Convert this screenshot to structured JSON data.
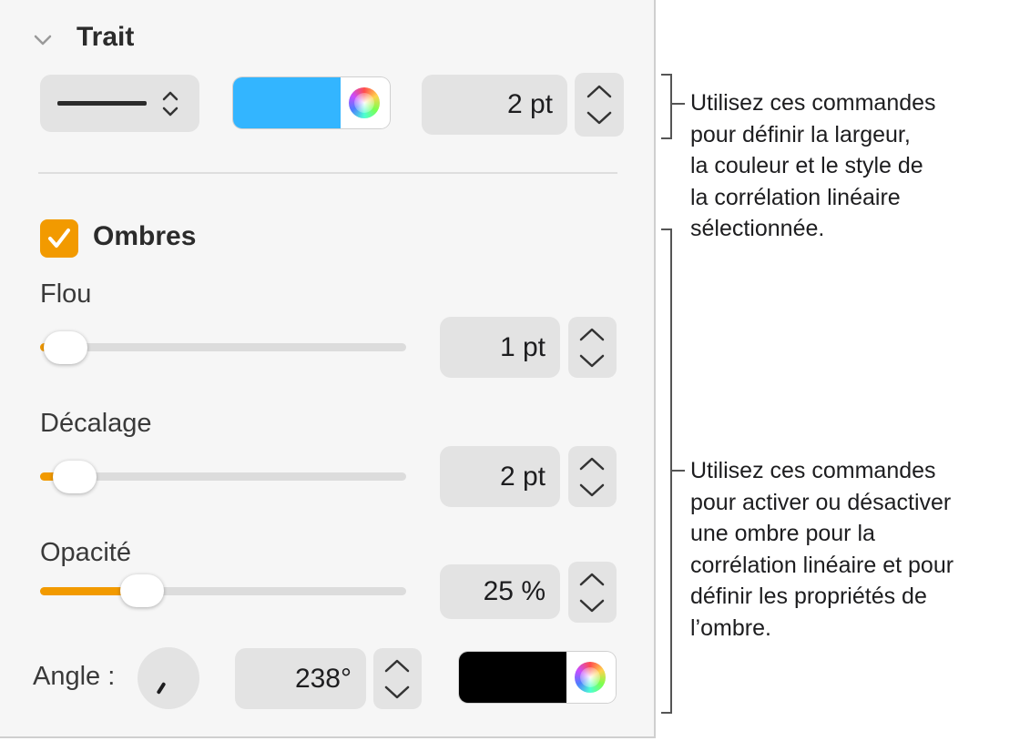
{
  "stroke": {
    "title": "Trait",
    "line_style": "solid-line",
    "color": "#33b5ff",
    "width_value": "2 pt"
  },
  "shadow": {
    "checkbox_checked": true,
    "title": "Ombres",
    "blur": {
      "label": "Flou",
      "value": "1 pt",
      "level": 0.02
    },
    "offset": {
      "label": "Décalage",
      "value": "2 pt",
      "level": 0.04
    },
    "opacity": {
      "label": "Opacité",
      "value": "25 %",
      "level": 0.25
    },
    "angle": {
      "label": "Angle :",
      "value": "238°"
    },
    "color": "#000000",
    "accent": "#f29a00"
  },
  "annotations": {
    "stroke_lines": [
      "Utilisez ces commandes",
      "pour définir la largeur,",
      "la couleur et le style de",
      "la corrélation linéaire",
      "sélectionnée."
    ],
    "shadow_lines": [
      "Utilisez ces commandes",
      "pour activer ou désactiver",
      "une ombre pour la",
      "corrélation linéaire et pour",
      "définir les propriétés de",
      "l’ombre."
    ]
  }
}
